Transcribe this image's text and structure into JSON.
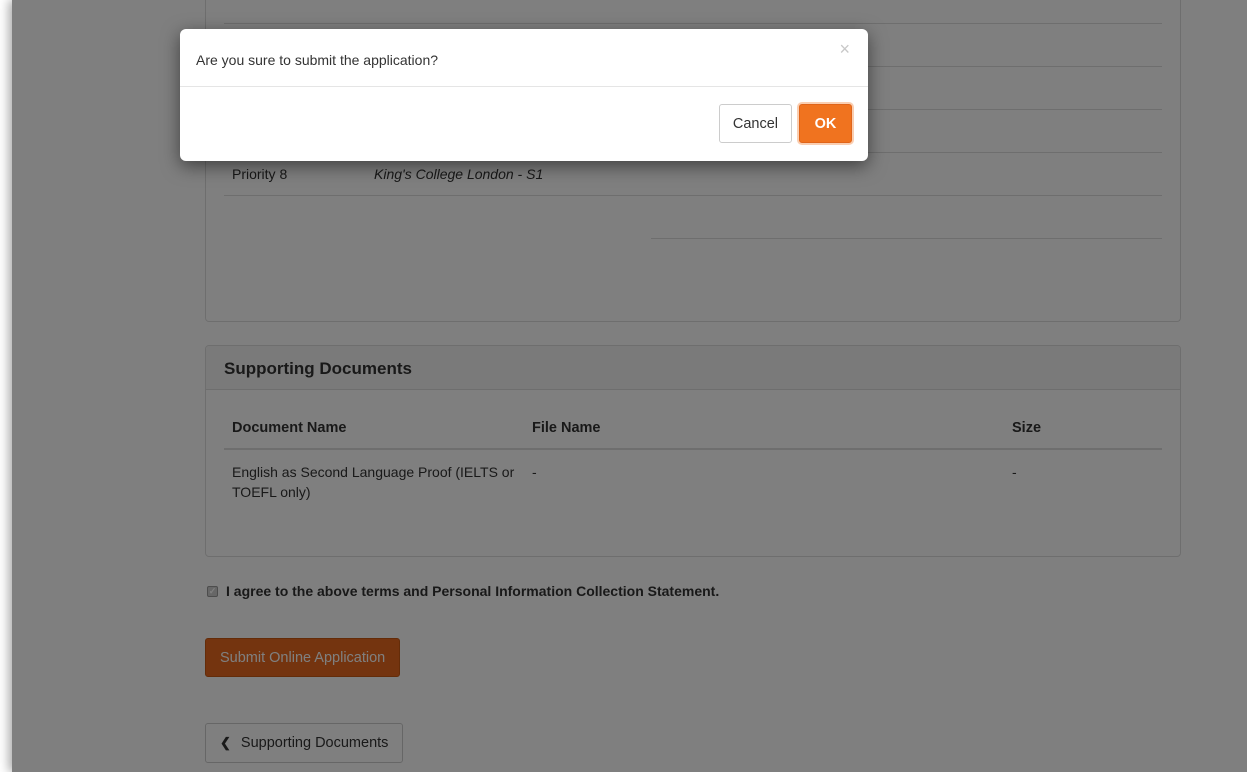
{
  "priorities": {
    "rows": [
      {
        "label": "",
        "value": ""
      },
      {
        "label": "",
        "value": ""
      },
      {
        "label": "",
        "value": ""
      },
      {
        "label": "",
        "value": ""
      },
      {
        "label": "Priority 8",
        "value": "King's College London - S1"
      }
    ]
  },
  "supporting_documents": {
    "title": "Supporting Documents",
    "columns": [
      "Document Name",
      "File Name",
      "Size"
    ],
    "rows": [
      {
        "document_name": "English as Second Language Proof (IELTS or TOEFL only)",
        "file_name": "-",
        "size": "-"
      }
    ]
  },
  "agreement": {
    "label": "I agree to the above terms and Personal Information Collection Statement.",
    "checked": true
  },
  "actions": {
    "submit_label": "Submit Online Application",
    "back_label": "Supporting Documents"
  },
  "dialog": {
    "message": "Are you sure to submit the application?",
    "close_glyph": "×",
    "cancel_label": "Cancel",
    "ok_label": "OK"
  },
  "colors": {
    "accent": "#f0731f",
    "backdrop": "rgba(0,0,0,0.5)"
  }
}
